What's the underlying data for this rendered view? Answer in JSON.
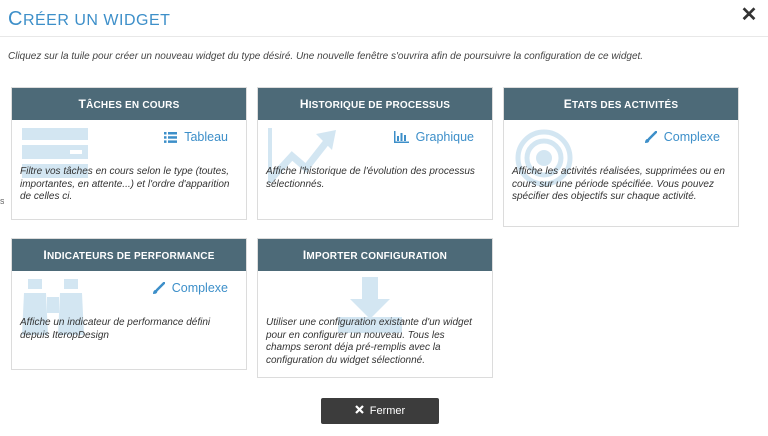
{
  "dialog": {
    "title_first": "C",
    "title_rest": "réer un widget",
    "close_glyph": "✕",
    "intro": "Cliquez sur la tuile pour créer un nouveau widget du type désiré. Une nouvelle fenêtre s'ouvrira afin de poursuivre la configuration de ce widget."
  },
  "tiles": [
    {
      "header_first": "T",
      "header_rest": "âches en cours",
      "type_label": "Tableau",
      "type_icon": "list-icon",
      "bg_icon": "table-icon",
      "description": "Filtre vos tâches en cours selon le type (toutes, importantes, en attente...) et l'ordre d'apparition de celles ci."
    },
    {
      "header_first": "H",
      "header_rest": "istorique de processus",
      "type_label": "Graphique",
      "type_icon": "bar-chart-icon",
      "bg_icon": "trend-arrow-icon",
      "description": "Affiche l'historique de l'évolution des processus sélectionnés."
    },
    {
      "header_first": "E",
      "header_rest": "tats des activités",
      "type_label": "Complexe",
      "type_icon": "brush-icon",
      "bg_icon": "target-icon",
      "description": "Affiche les activités réalisées, supprimées ou en cours sur une période spécifiée. Vous pouvez spécifier des objectifs sur chaque activité."
    },
    {
      "header_first": "I",
      "header_rest": "ndicateurs de performance",
      "type_label": "Complexe",
      "type_icon": "brush-icon",
      "bg_icon": "binoculars-icon",
      "description": "Affiche un indicateur de performance défini depuis IteropDesign"
    },
    {
      "header_first": "I",
      "header_rest": "mporter configuration",
      "bg_icon": "download-icon",
      "description": "Utiliser une configuration existante d'un widget pour en configurer un nouveau. Tous les champs seront déja pré-remplis avec la configuration du widget sélectionné."
    }
  ],
  "footer": {
    "close_label": "Fermer",
    "close_icon": "close-icon"
  },
  "colors": {
    "accent": "#3d8fc9",
    "header_bg": "#4d6a78",
    "button_bg": "#3c3c3c"
  }
}
